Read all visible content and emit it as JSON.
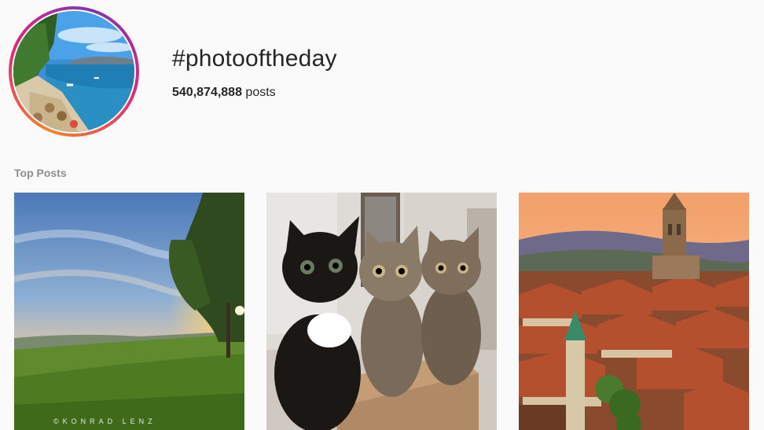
{
  "header": {
    "hashtag": "#photooftheday",
    "post_count": "540,874,888",
    "post_count_suffix": " posts"
  },
  "top_posts": {
    "label": "Top Posts",
    "posts": [
      {
        "subject": "sunset meadow with tree",
        "watermark": "©KONRAD LENZ"
      },
      {
        "subject": "three kittens"
      },
      {
        "subject": "old town rooftops with cathedral"
      }
    ]
  }
}
